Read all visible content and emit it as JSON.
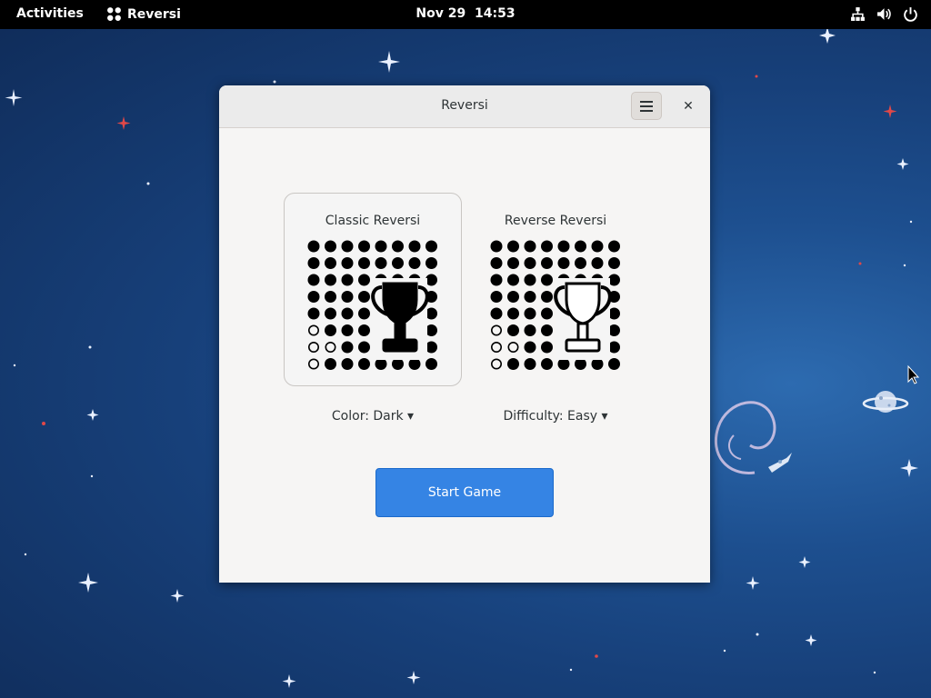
{
  "topbar": {
    "activities": "Activities",
    "app_name": "Reversi",
    "date": "Nov 29",
    "time": "14:53"
  },
  "window": {
    "title": "Reversi",
    "close_glyph": "✕"
  },
  "modes": [
    {
      "title": "Classic Reversi",
      "selected": true
    },
    {
      "title": "Reverse Reversi",
      "selected": false
    }
  ],
  "options": {
    "color": "Color: Dark ▾",
    "difficulty": "Difficulty: Easy ▾"
  },
  "start_button": "Start Game",
  "icons": {
    "app": "reversi-app-icon",
    "network": "network-icon",
    "volume": "volume-icon",
    "power": "power-icon",
    "menu": "hamburger-menu-icon",
    "trophy": "trophy-icon"
  },
  "colors": {
    "accent": "#3584e4",
    "topbar": "#000000",
    "window_bg": "#f6f5f4"
  }
}
